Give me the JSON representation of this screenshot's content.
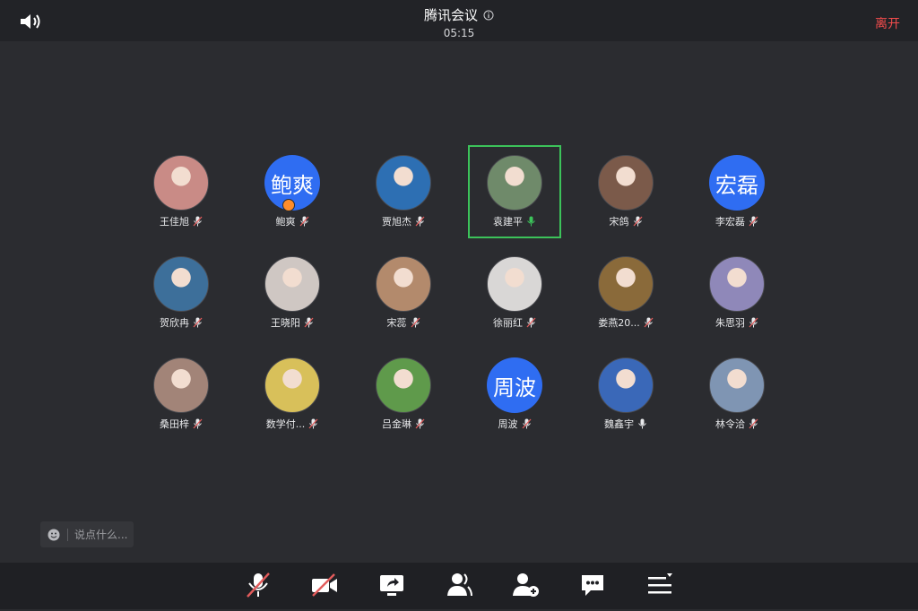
{
  "header": {
    "title": "腾讯会议",
    "timer": "05:15",
    "leave_label": "离开"
  },
  "participants": [
    {
      "name": "王佳旭",
      "avatar": "photo",
      "color": "#c98b86",
      "mic": "muted"
    },
    {
      "name": "鲍爽",
      "avatar": "text",
      "avatar_text": "鲍爽",
      "color": "#2f6df2",
      "mic": "muted",
      "host": true
    },
    {
      "name": "贾旭杰",
      "avatar": "photo",
      "color": "#2d6fb3",
      "mic": "muted"
    },
    {
      "name": "袁建平",
      "avatar": "photo",
      "color": "#6f8a6a",
      "mic": "active",
      "speaking": true
    },
    {
      "name": "宋鸽",
      "avatar": "photo",
      "color": "#7b5a4a",
      "mic": "muted"
    },
    {
      "name": "李宏磊",
      "avatar": "text",
      "avatar_text": "宏磊",
      "color": "#2f6df2",
      "mic": "muted"
    },
    {
      "name": "贺欣冉",
      "avatar": "photo",
      "color": "#3d6f9a",
      "mic": "muted"
    },
    {
      "name": "王晓阳",
      "avatar": "photo",
      "color": "#cfc7c3",
      "mic": "muted"
    },
    {
      "name": "宋蕊",
      "avatar": "photo",
      "color": "#b38a6c",
      "mic": "muted"
    },
    {
      "name": "徐丽红",
      "avatar": "photo",
      "color": "#d9d7d6",
      "mic": "muted"
    },
    {
      "name": "娄燕20...",
      "avatar": "photo",
      "color": "#8a6a3a",
      "mic": "muted"
    },
    {
      "name": "朱思羽",
      "avatar": "photo",
      "color": "#8f88b9",
      "mic": "muted"
    },
    {
      "name": "桑田梓",
      "avatar": "photo",
      "color": "#a28478",
      "mic": "muted"
    },
    {
      "name": "数学付...",
      "avatar": "photo",
      "color": "#d8c05a",
      "mic": "muted"
    },
    {
      "name": "吕金琳",
      "avatar": "photo",
      "color": "#5f9a4b",
      "mic": "muted"
    },
    {
      "name": "周波",
      "avatar": "text",
      "avatar_text": "周波",
      "color": "#2f6df2",
      "mic": "muted"
    },
    {
      "name": "魏鑫宇",
      "avatar": "photo",
      "color": "#3a68b8",
      "mic": "on"
    },
    {
      "name": "林令洽",
      "avatar": "photo",
      "color": "#7f95b3",
      "mic": "muted"
    }
  ],
  "chat": {
    "placeholder": "说点什么..."
  },
  "colors": {
    "accent": "#2f6df2",
    "speaking": "#3cc35a",
    "leave": "#f24c4c",
    "muted": "#e25b5b"
  }
}
